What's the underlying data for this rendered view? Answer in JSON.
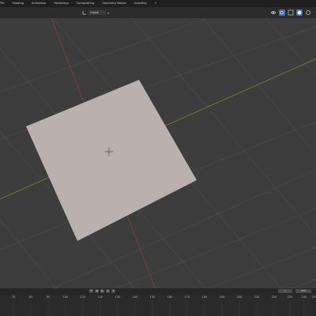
{
  "workspace_tabs": [
    "Yle",
    "Shading",
    "Animation",
    "Rendering",
    "Compositing",
    "Geometry Nodes",
    "Scripting",
    "+"
  ],
  "header": {
    "transform_pivot_label": "Global",
    "icons": [
      "eye-icon",
      "overlay-icon",
      "xray-icon",
      "shading-solid-icon",
      "shading-material-icon"
    ]
  },
  "viewport": {
    "object": "plane",
    "origin_marker": "3D cursor"
  },
  "timeline": {
    "controls": [
      "⏮",
      "◀",
      "▶",
      "⏭",
      "⏹"
    ],
    "current_frame": "1",
    "end_frame": "250",
    "ruler_labels": [
      "70",
      "80",
      "90",
      "100",
      "110",
      "120",
      "130",
      "140",
      "150",
      "160",
      "170",
      "180",
      "190",
      "200",
      "210",
      "220",
      "230",
      "240",
      "250"
    ]
  },
  "colors": {
    "background": "#3d3d3d",
    "grid": "#4a4a4a",
    "x_axis": "#8a3a40",
    "y_axis": "#6c8a2c",
    "plane": "#bab0ae"
  }
}
